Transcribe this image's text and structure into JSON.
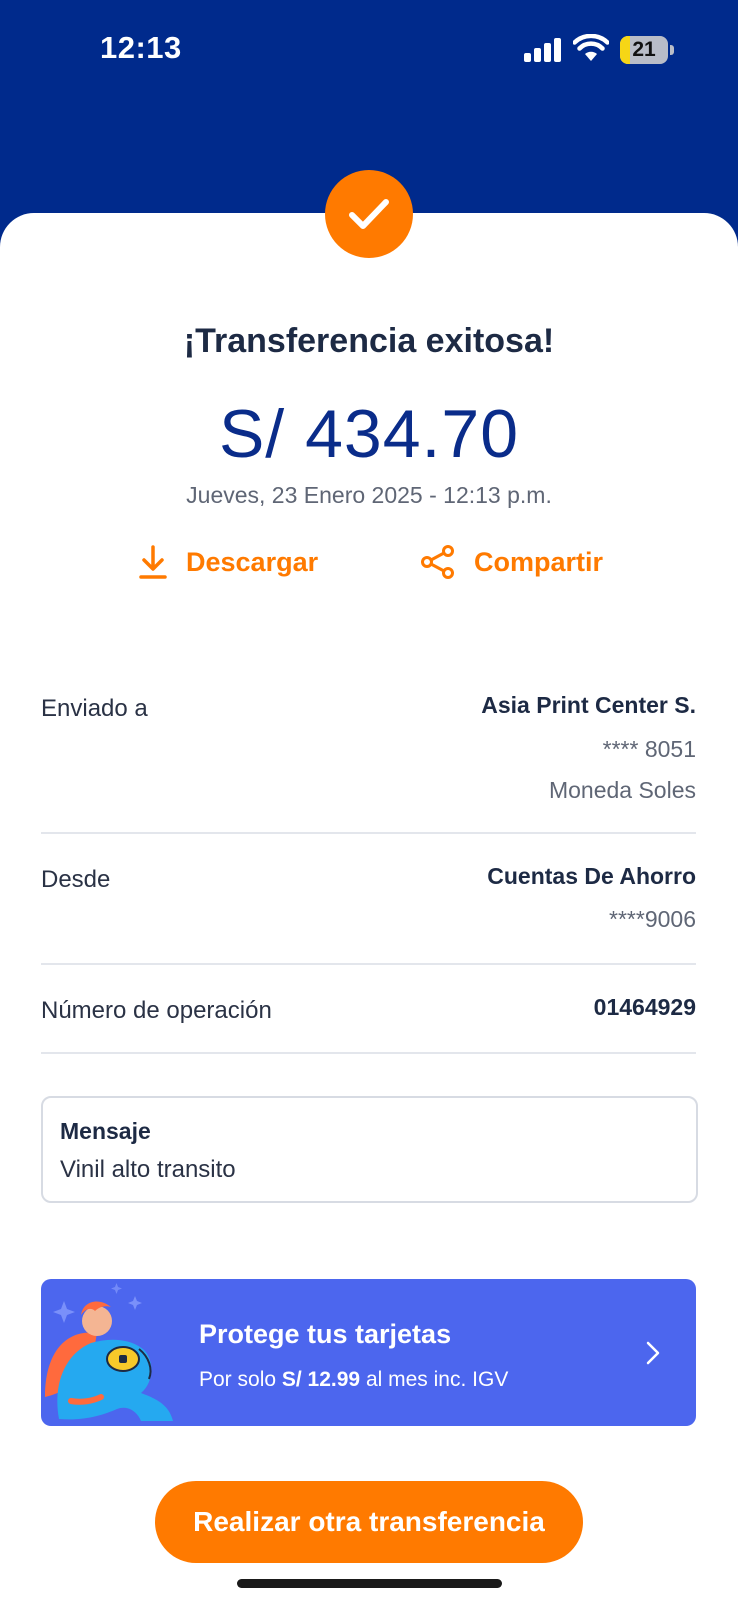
{
  "status_bar": {
    "time": "12:13",
    "battery": "21",
    "battery_level": 0.21
  },
  "receipt": {
    "title": "¡Transferencia exitosa!",
    "amount": "S/ 434.70",
    "datetime": "Jueves, 23 Enero 2025 - 12:13 p.m."
  },
  "actions": {
    "download": "Descargar",
    "share": "Compartir"
  },
  "details": {
    "sent_to": {
      "label": "Enviado a",
      "name": "Asia Print Center S.",
      "account": "**** 8051",
      "currency": "Moneda Soles"
    },
    "from": {
      "label": "Desde",
      "name": "Cuentas De Ahorro",
      "account": "****9006"
    },
    "operation": {
      "label": "Número de operación",
      "value": "01464929"
    }
  },
  "message": {
    "label": "Mensaje",
    "text": "Vinil alto transito"
  },
  "promo": {
    "title": "Protege tus tarjetas",
    "text_before": "Por solo ",
    "price": "S/ 12.99",
    "text_after": " al mes inc. IGV"
  },
  "cta": {
    "label": "Realizar otra transferencia"
  },
  "colors": {
    "header": "#002a8c",
    "accent": "#ff7a00",
    "amount": "#0a2c8a",
    "promo": "#4c66ee"
  }
}
